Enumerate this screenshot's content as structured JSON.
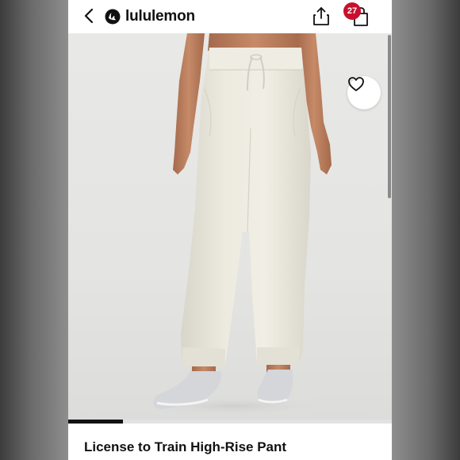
{
  "header": {
    "brand_name": "lululemon",
    "bag_count": "27",
    "icons": [
      "back-chevron-icon",
      "lululemon-logo-icon",
      "share-icon",
      "shopping-bag-icon"
    ]
  },
  "hero": {
    "wishlist_icon": "heart-icon",
    "carousel_progress": 0.17
  },
  "product": {
    "title": "License to Train High-Rise Pant"
  },
  "colors": {
    "brand_red": "#c8102e",
    "text": "#111111"
  }
}
